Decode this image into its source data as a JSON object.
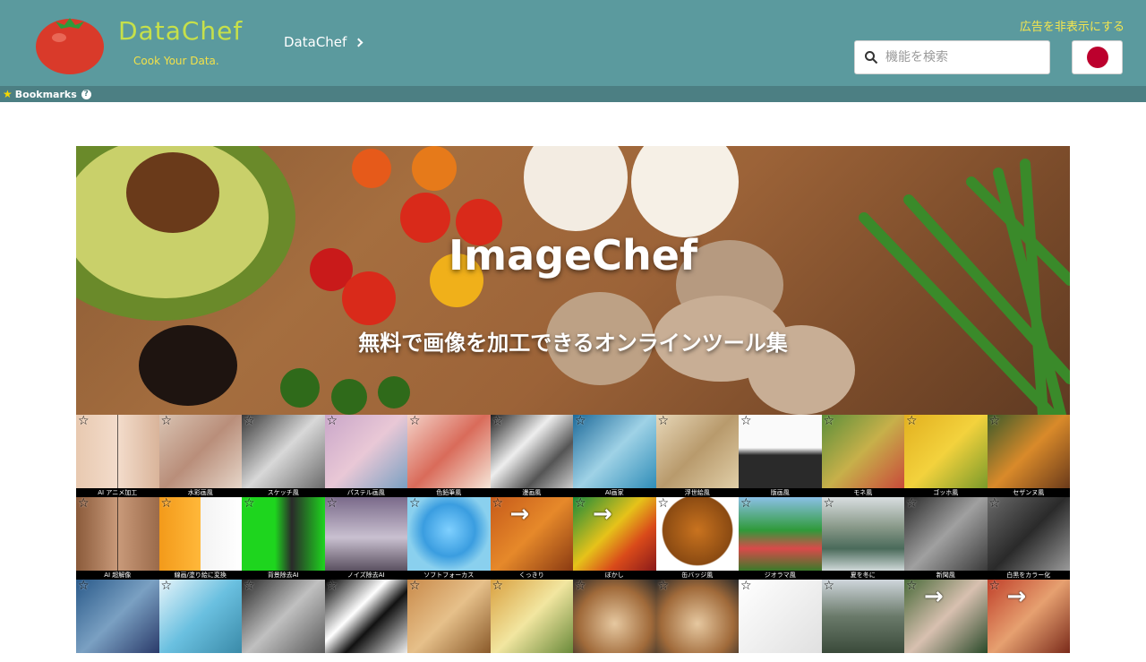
{
  "header": {
    "logo_title": "DataChef",
    "logo_subtitle": "Cook Your Data.",
    "breadcrumb": "DataChef",
    "hide_ads": "広告を非表示にする",
    "search_placeholder": "機能を検索",
    "language_flag": "japan-flag-icon"
  },
  "bookmarks": {
    "label": "Bookmarks",
    "help": "?"
  },
  "hero": {
    "title": "ImageChef",
    "subtitle": "無料で画像を加工できるオンラインツール集"
  },
  "colors": {
    "header_bg": "#5b9a9e",
    "bookmarks_bg": "#4c7f83",
    "logo_green": "#c6e04a",
    "accent_yellow": "#f5e64f"
  },
  "tiles": [
    {
      "label": "AI アニメ加工",
      "bg": "linear-gradient(90deg,#e8c9b0,#f3dccb 50%,#d9b49a)",
      "split": true
    },
    {
      "label": "水彩画風",
      "bg": "linear-gradient(135deg,#d9c3b2,#b98e7a,#e6d6c9)"
    },
    {
      "label": "スケッチ風",
      "bg": "linear-gradient(135deg,#3a3a3a,#d8d8d8 50%,#6b6b6b)"
    },
    {
      "label": "パステル画風",
      "bg": "linear-gradient(135deg,#c9a6c9,#e9c8d6,#7aa0c2)"
    },
    {
      "label": "色鉛筆風",
      "bg": "linear-gradient(135deg,#f4d2c8,#d96b5a,#f6e6d8)"
    },
    {
      "label": "漫画風",
      "bg": "linear-gradient(135deg,#222,#eee 40%,#555 70%,#ccc)"
    },
    {
      "label": "AI画家",
      "bg": "linear-gradient(135deg,#1d6a9a,#9fd2e6,#2f8db8)"
    },
    {
      "label": "浮世絵風",
      "bg": "linear-gradient(135deg,#e7d7b8,#b89a6c,#e1cfa8)"
    },
    {
      "label": "版画風",
      "bg": "linear-gradient(180deg,#fafafa 0%,#fafafa 45%,#2a2a2a 55%,#2a2a2a 100%)"
    },
    {
      "label": "モネ風",
      "bg": "linear-gradient(135deg,#5b8f3a,#c7b04a,#c84a3a)"
    },
    {
      "label": "ゴッホ風",
      "bg": "linear-gradient(135deg,#e2b01f,#f3d23d,#7a9a2a)"
    },
    {
      "label": "セザンヌ風",
      "bg": "linear-gradient(135deg,#3c5a2a,#d98a2a,#6a3a1a)"
    },
    {
      "label": "AI 超解像",
      "bg": "linear-gradient(90deg,#8a5a3a,#c99a7a 50%,#9a6a4a)",
      "split": true
    },
    {
      "label": "線画/塗り絵に変換",
      "bg": "linear-gradient(90deg,#f39a1a,#ffb83a 50%,#f3f3f3 50%,#ffffff)"
    },
    {
      "label": "背景除去AI",
      "bg": "linear-gradient(90deg,#1ed51e,#1ed51e 40%,#2a2a2a 60%,#1ed51e)"
    },
    {
      "label": "ノイズ除去AI",
      "bg": "linear-gradient(180deg,#7a6a8a,#c9c0d0 55%,#5a5060)"
    },
    {
      "label": "ソフトフォーカス",
      "bg": "radial-gradient(circle at 50% 45%,#7fd0ff,#3a9de0 45%,#8ad0ee 70%)"
    },
    {
      "label": "くっきり",
      "bg": "linear-gradient(135deg,#c65a1a,#e6892a,#8a3a12)",
      "arrow": true
    },
    {
      "label": "ぼかし",
      "bg": "linear-gradient(135deg,#1a8a3a,#e6c21a 45%,#d94a1a 70%,#8a1a1a)",
      "arrow": true
    },
    {
      "label": "缶バッジ風",
      "bg": "radial-gradient(circle at 50% 45%,#c9731f,#8a4a12 60%,#ffffff 62%)"
    },
    {
      "label": "ジオラマ風",
      "bg": "linear-gradient(180deg,#8ac0e6,#2f9a3a 45%,#d94a4a 70%,#3a7a2a)"
    },
    {
      "label": "夏を冬に",
      "bg": "linear-gradient(180deg,#d8dde0,#8a9a8a 40%,#4a6a5a 70%,#cfd8d8)"
    },
    {
      "label": "新聞風",
      "bg": "linear-gradient(135deg,#2a2a2a,#a0a0a0,#3a3a3a)"
    },
    {
      "label": "白黒をカラー化",
      "bg": "linear-gradient(135deg,#6a6a6a,#2a2a2a 50%,#9a9a9a)"
    },
    {
      "label": "",
      "bg": "linear-gradient(135deg,#2a5a8a,#7aa0c2,#2a3a6a)"
    },
    {
      "label": "",
      "bg": "linear-gradient(135deg,#e6f4fa,#6ac0e0,#3a8aa8)"
    },
    {
      "label": "",
      "bg": "linear-gradient(135deg,#2a2a2a,#c0c0c0,#5a5a5a)"
    },
    {
      "label": "",
      "bg": "linear-gradient(135deg,#000,#fff 40%,#111 60%,#eee)"
    },
    {
      "label": "",
      "bg": "linear-gradient(135deg,#c98a4a,#e6c08a,#8a5a2a)"
    },
    {
      "label": "",
      "bg": "linear-gradient(135deg,#d9a040,#f2e6a0,#6a8a3a)"
    },
    {
      "label": "",
      "bg": "radial-gradient(circle at 50% 60%,#e6c8a0,#a06a3a 60%,#2a2a2a)"
    },
    {
      "label": "",
      "bg": "radial-gradient(circle at 50% 60%,#e6c8a0,#a06a3a 60%,#2a2a2a)"
    },
    {
      "label": "",
      "bg": "linear-gradient(135deg,#ffffff,#f0f0f0,#e0e0e0)"
    },
    {
      "label": "",
      "bg": "linear-gradient(180deg,#cfd6dc,#6a7a6a,#3a4a3a)"
    },
    {
      "label": "",
      "bg": "linear-gradient(135deg,#4a6a3a,#d8c0b0,#2a4a2a)",
      "arrow": true
    },
    {
      "label": "",
      "bg": "linear-gradient(135deg,#c0402a,#e6a070,#7a2a1a)",
      "arrow": true
    }
  ]
}
